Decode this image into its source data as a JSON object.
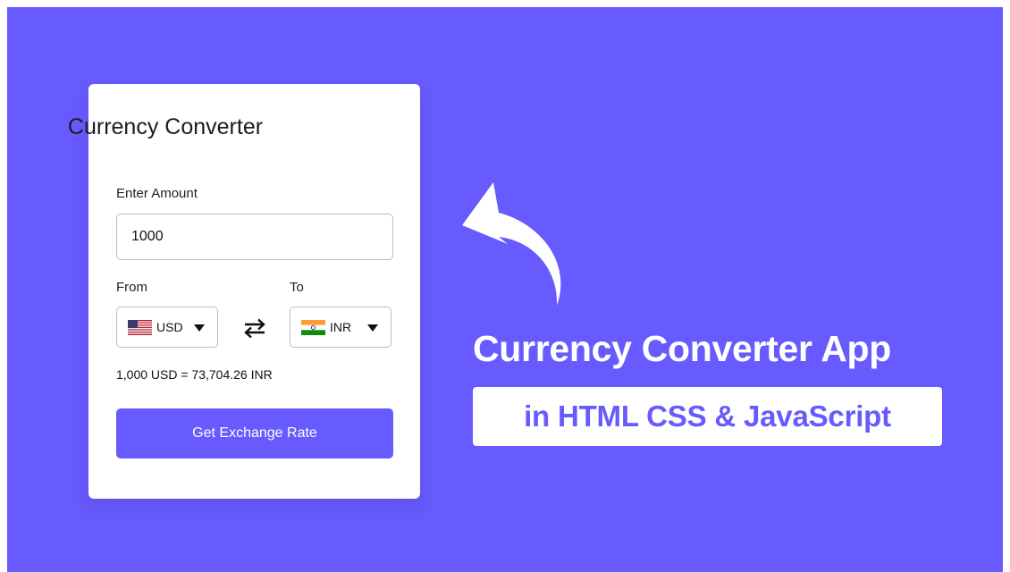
{
  "card": {
    "title": "Currency Converter",
    "amount_label": "Enter Amount",
    "amount_value": "1000",
    "from_label": "From",
    "to_label": "To",
    "from_currency": "USD",
    "from_flag": "us-flag-icon",
    "to_currency": "INR",
    "to_flag": "india-flag-icon",
    "swap_icon": "swap-arrows-icon",
    "rate_text": "1,000 USD = 73,704.26 INR",
    "button_label": "Get Exchange Rate"
  },
  "banner": {
    "headline": "Currency Converter App",
    "subtitle": "in HTML CSS & JavaScript",
    "arrow_icon": "curved-arrow-icon"
  },
  "colors": {
    "accent": "#675afe",
    "card_background": "#ffffff",
    "text": "#111111"
  }
}
